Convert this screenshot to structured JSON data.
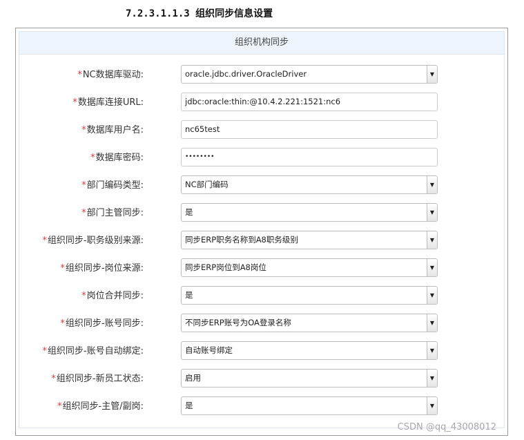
{
  "document": {
    "heading": "7.2.3.1.1.3 组织同步信息设置"
  },
  "panel": {
    "title": "组织机构同步"
  },
  "required_mark": "*",
  "fields": [
    {
      "label": "NC数据库驱动:",
      "value": "oracle.jdbc.driver.OracleDriver",
      "type": "select"
    },
    {
      "label": "数据库连接URL:",
      "value": "jdbc:oracle:thin:@10.4.2.221:1521:nc6",
      "type": "text"
    },
    {
      "label": "数据库用户名:",
      "value": "nc65test",
      "type": "text"
    },
    {
      "label": "数据库密码:",
      "value": "••••••••",
      "type": "password"
    },
    {
      "label": "部门编码类型:",
      "value": "NC部门编码",
      "type": "select"
    },
    {
      "label": "部门主管同步:",
      "value": "是",
      "type": "select"
    },
    {
      "label": "组织同步-职务级别来源:",
      "value": "同步ERP职务名称到A8职务级别",
      "type": "select"
    },
    {
      "label": "组织同步-岗位来源:",
      "value": "同步ERP岗位到A8岗位",
      "type": "select"
    },
    {
      "label": "岗位合并同步:",
      "value": "是",
      "type": "select"
    },
    {
      "label": "组织同步-账号同步:",
      "value": "不同步ERP账号为OA登录名称",
      "type": "select"
    },
    {
      "label": "组织同步-账号自动绑定:",
      "value": "自动账号绑定",
      "type": "select"
    },
    {
      "label": "组织同步-新员工状态:",
      "value": "启用",
      "type": "select"
    },
    {
      "label": "组织同步-主管/副岗:",
      "value": "是",
      "type": "select"
    }
  ],
  "watermark": "CSDN @qq_43008012",
  "icons": {
    "select_arrow": "chevron-down-icon"
  }
}
